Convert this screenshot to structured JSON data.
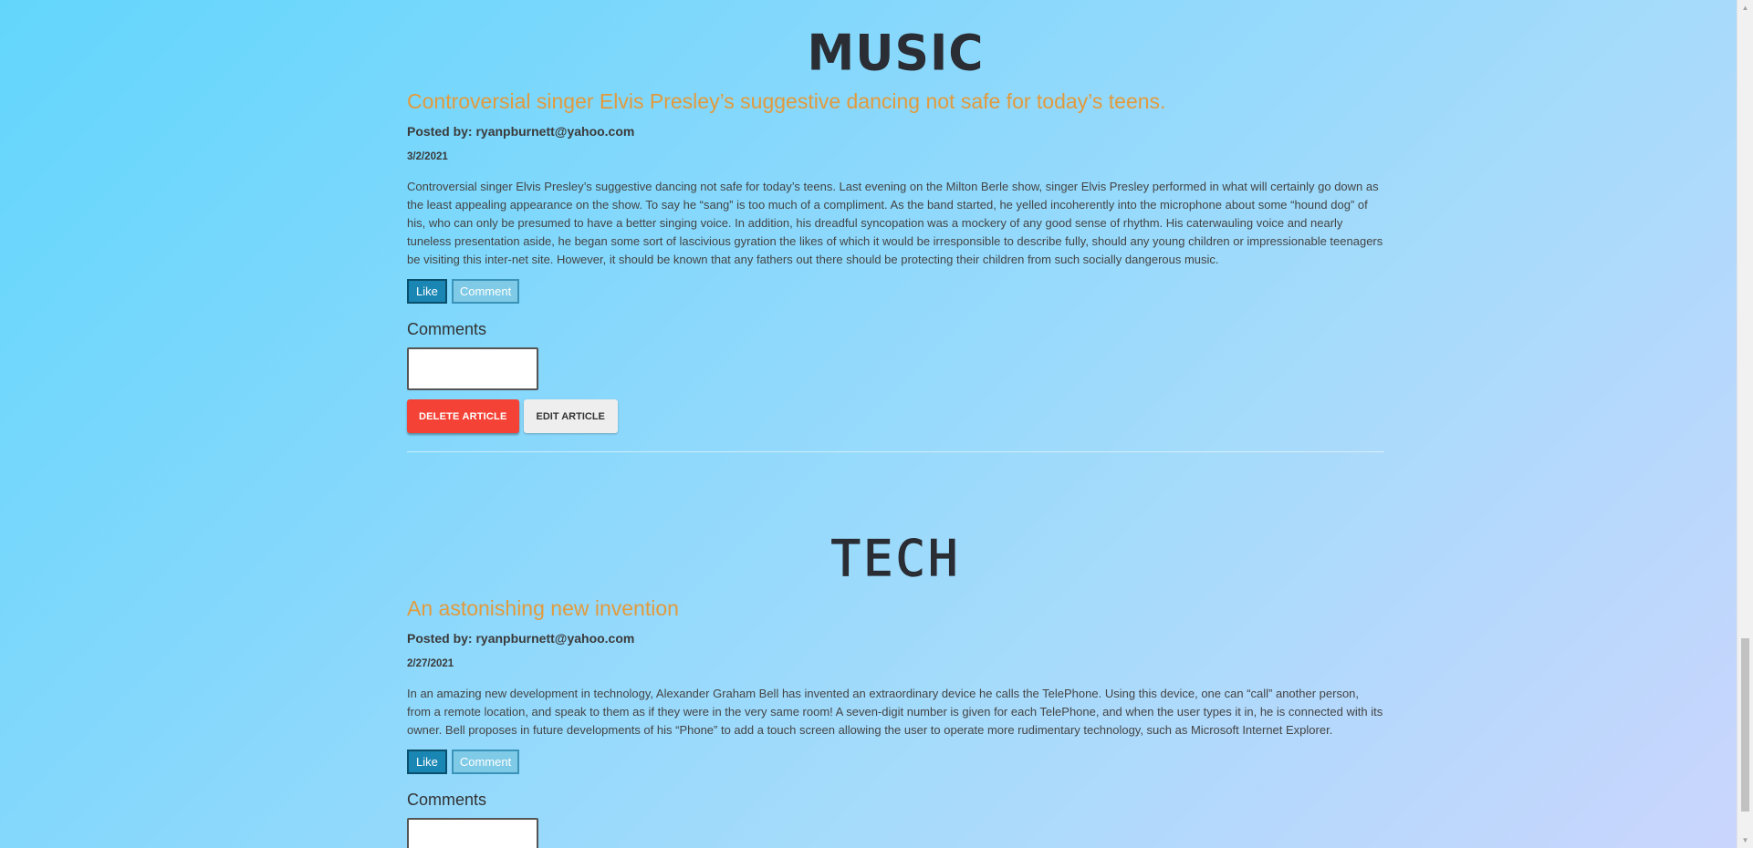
{
  "articles": [
    {
      "category": "MUSIC",
      "title": "Controversial singer Elvis Presley’s suggestive dancing not safe for today’s teens.",
      "posted_by": "Posted by: ryanpburnett@yahoo.com",
      "date": "3/2/2021",
      "body": "Controversial singer Elvis Presley’s suggestive dancing not safe for today’s teens. Last evening on the Milton Berle show, singer Elvis Presley performed in what will certainly go down as the least appealing appearance on the show. To say he “sang” is too much of a compliment. As the band started, he yelled incoherently into the microphone about some “hound dog” of his, who can only be presumed to have a better singing voice. In addition, his dreadful syncopation was a mockery of any good sense of rhythm. His caterwauling voice and nearly tuneless presentation aside, he began some sort of lascivious gyration the likes of which it would be irresponsible to describe fully, should any young children or impressionable teenagers be visiting this inter-net site. However, it should be known that any fathers out there should be protecting their children from such socially dangerous music.",
      "like_label": "Like",
      "comment_label": "Comment",
      "comments_heading": "Comments",
      "comment_value": "",
      "delete_label": "DELETE ARTICLE",
      "edit_label": "EDIT ARTICLE"
    },
    {
      "category": "TECH",
      "title": "An astonishing new invention",
      "posted_by": "Posted by: ryanpburnett@yahoo.com",
      "date": "2/27/2021",
      "body": "In an amazing new development in technology, Alexander Graham Bell has invented an extraordinary device he calls the TelePhone. Using this device, one can “call” another person, from a remote location, and speak to them as if they were in the very same room! A seven-digit number is given for each TelePhone, and when the user types it in, he is connected with its owner. Bell proposes in future developments of his “Phone” to add a touch screen allowing the user to operate more rudimentary technology, such as Microsoft Internet Explorer.",
      "like_label": "Like",
      "comment_label": "Comment",
      "comments_heading": "Comments",
      "comment_value": ""
    }
  ],
  "colors": {
    "title": "#e29a3c",
    "like_button": "#1a86b4",
    "comment_button": "#7fcbe7",
    "delete_button": "#f44336",
    "edit_button": "#eeeeee"
  }
}
